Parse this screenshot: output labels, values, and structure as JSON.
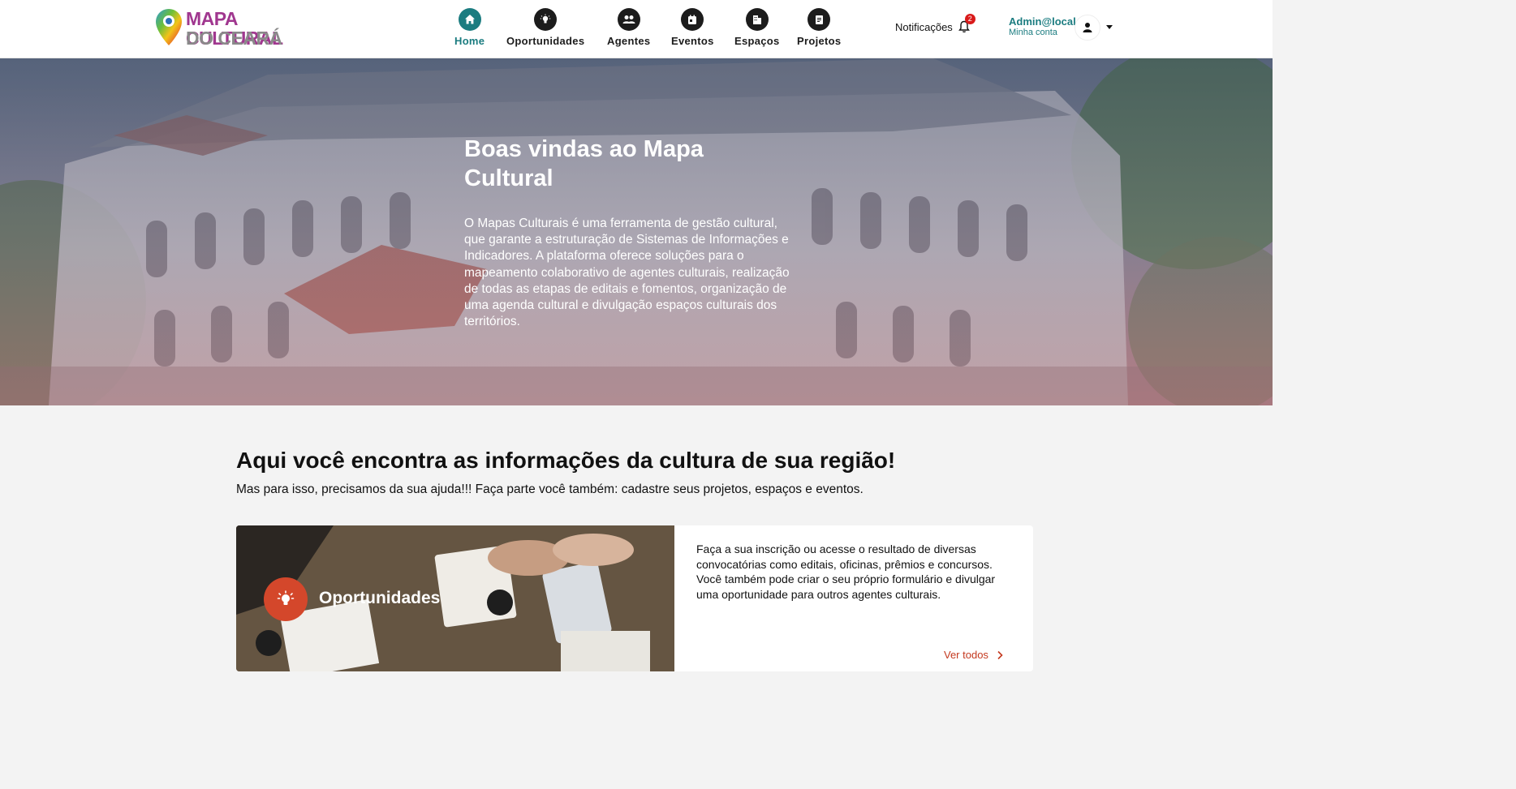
{
  "header": {
    "logo_line1": "MAPA CULTURAL",
    "logo_line2": "DO CEARÁ",
    "nav": [
      {
        "label": "Home",
        "icon": "home-icon",
        "active": true
      },
      {
        "label": "Oportunidades",
        "icon": "lightbulb-icon",
        "active": false
      },
      {
        "label": "Agentes",
        "icon": "people-icon",
        "active": false
      },
      {
        "label": "Eventos",
        "icon": "calendar-icon",
        "active": false
      },
      {
        "label": "Espaços",
        "icon": "building-icon",
        "active": false
      },
      {
        "label": "Projetos",
        "icon": "document-icon",
        "active": false
      }
    ],
    "notifications_label": "Notificações",
    "notifications_count": "2",
    "user_name": "Admin@local",
    "user_sub": "Minha conta"
  },
  "hero": {
    "title": "Boas vindas ao Mapa Cultural",
    "text": "O Mapas Culturais é uma ferramenta de gestão cultural, que garante a estruturação de Sistemas de Informações e Indicadores. A plataforma oferece soluções para o mapeamento colaborativo de agentes culturais, realização de todas as etapas de editais e fomentos, organização de uma agenda cultural e divulgação espaços culturais dos territórios."
  },
  "main": {
    "title": "Aqui você encontra as informações da cultura de sua região!",
    "subtitle": "Mas para isso, precisamos da sua ajuda!!! Faça parte você também: cadastre seus projetos, espaços e eventos.",
    "card": {
      "title": "Oportunidades",
      "icon": "lightbulb-icon",
      "text": "Faça a sua inscrição ou acesse o resultado de diversas convocatórias como editais, oficinas, prêmios e concursos. Você também pode criar o seu próprio formulário e divulgar uma oportunidade para outros agentes culturais.",
      "link": "Ver todos"
    }
  },
  "colors": {
    "accent": "#1b7c80",
    "brand_purple": "#a0378f",
    "opportunity": "#d4472b",
    "link": "#c4391f"
  }
}
